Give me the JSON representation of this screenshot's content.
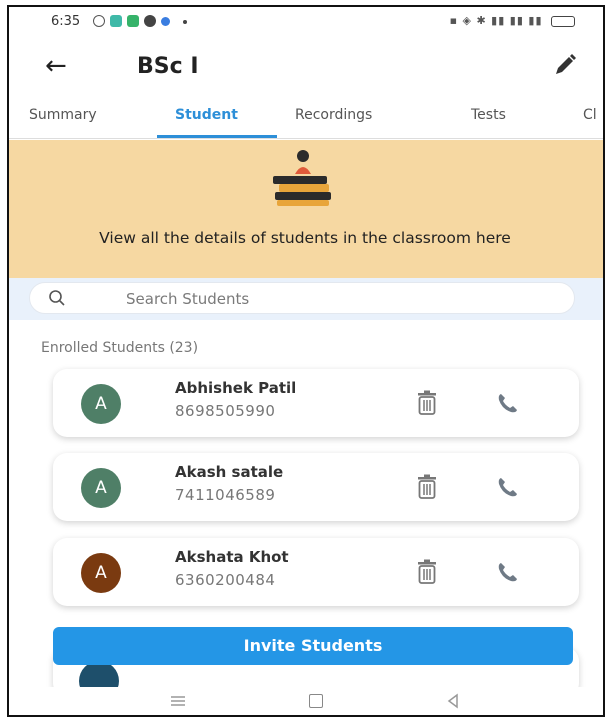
{
  "status_bar": {
    "time": "6:35"
  },
  "app_bar": {
    "title": "BSc I"
  },
  "tabs": [
    {
      "label": "Summary"
    },
    {
      "label": "Student",
      "active": true
    },
    {
      "label": "Recordings"
    },
    {
      "label": "Tests"
    },
    {
      "label": "Cl"
    }
  ],
  "banner": {
    "text": "View all the details of students in the classroom here"
  },
  "search": {
    "placeholder": "Search Students"
  },
  "enrolled": {
    "label": "Enrolled Students (23)"
  },
  "students": [
    {
      "initial": "A",
      "name": "Abhishek Patil",
      "phone": "8698505990",
      "avatar_color": "#4f7f67"
    },
    {
      "initial": "A",
      "name": "Akash satale",
      "phone": "7411046589",
      "avatar_color": "#4f7f67"
    },
    {
      "initial": "A",
      "name": "Akshata Khot",
      "phone": "6360200484",
      "avatar_color": "#7a3a10"
    }
  ],
  "invite_button": {
    "label": "Invite Students"
  },
  "colors": {
    "accent": "#2d8fd8",
    "banner": "#f6d8a2",
    "button": "#2496e6"
  }
}
